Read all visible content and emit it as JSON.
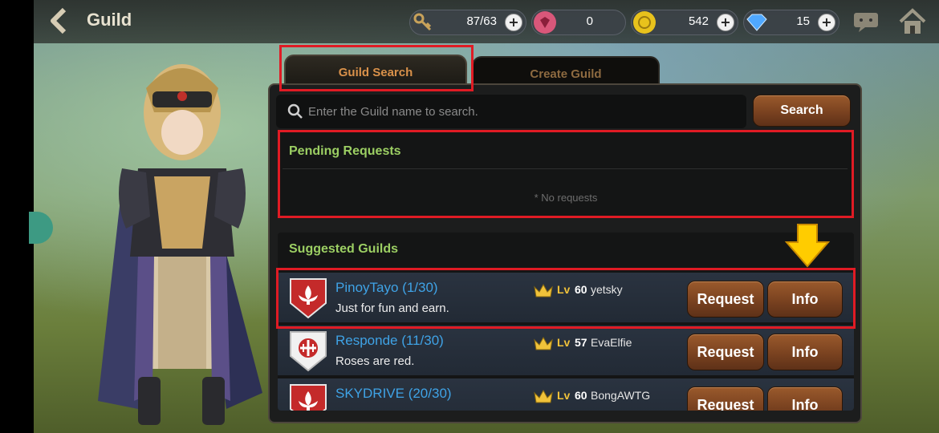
{
  "header": {
    "title": "Guild"
  },
  "resources": [
    {
      "icon": "key-icon",
      "value": "87/63"
    },
    {
      "icon": "ruby-icon",
      "value": "0"
    },
    {
      "icon": "gold-coin-icon",
      "value": "542"
    },
    {
      "icon": "diamond-icon",
      "value": "15"
    }
  ],
  "tabs": [
    {
      "label": "Guild Search",
      "active": true
    },
    {
      "label": "Create Guild",
      "active": false
    }
  ],
  "search": {
    "placeholder": "Enter the Guild name to search.",
    "button_label": "Search"
  },
  "pending": {
    "title": "Pending Requests",
    "empty_text": "* No requests"
  },
  "suggested": {
    "title": "Suggested Guilds",
    "level_label": "Lv",
    "request_label": "Request",
    "info_label": "Info",
    "guilds": [
      {
        "name": "PinoyTayo (1/30)",
        "description": "Just for fun and earn.",
        "level": "60",
        "leader": "yetsky",
        "emblem": "fleur-de-lis"
      },
      {
        "name": "Responde (11/30)",
        "description": "Roses are red.",
        "level": "57",
        "leader": "EvaElfie",
        "emblem": "cross-shield"
      },
      {
        "name": "SKYDRIVE (20/30)",
        "description": "",
        "level": "60",
        "leader": "BongAWTG",
        "emblem": "fleur-de-lis"
      }
    ]
  },
  "colors": {
    "accent_tab": "#d9914a",
    "section_title": "#9ccf63",
    "guild_name": "#3fa3e6",
    "highlight": "#e01b24",
    "button": "#7a4220"
  }
}
